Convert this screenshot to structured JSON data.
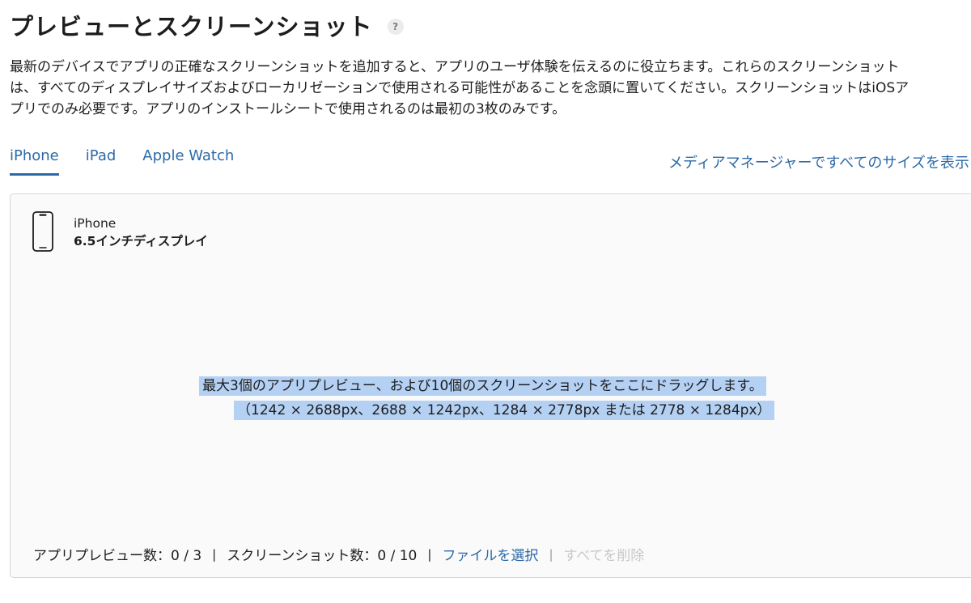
{
  "header": {
    "title": "プレビューとスクリーンショット",
    "help_icon": "?"
  },
  "description": {
    "lines": [
      "最新のデバイスでアプリの正確なスクリーンショットを追加すると、アプリのユーザ体験を伝えるのに役立ちます。これらのスクリーンショット",
      "は、すべてのディスプレイサイズおよびローカリゼーションで使用される可能性があることを念頭に置いてください。スクリーンショットはiOSア",
      "プリでのみ必要です。アプリのインストールシートで使用されるのは最初の3枚のみです。"
    ]
  },
  "tabs": [
    {
      "label": "iPhone",
      "active": true
    },
    {
      "label": "iPad",
      "active": false
    },
    {
      "label": "Apple Watch",
      "active": false
    }
  ],
  "media_manager_link": "メディアマネージャーですべてのサイズを表示",
  "device": {
    "icon": "iphone-icon",
    "name": "iPhone",
    "size": "6.5インチディスプレイ"
  },
  "drop_hint": {
    "line1": "最大3個のアプリプレビュー、および10個のスクリーンショットをここにドラッグします。",
    "line2": "（1242 × 2688px、2688 × 1242px、1284 × 2778px または 2778 × 1284px）"
  },
  "footer": {
    "preview_count": "アプリプレビュー数：0 / 3",
    "screenshot_count": "スクリーンショット数：0 / 10",
    "choose_file": "ファイルを選択",
    "delete_all": "すべてを削除",
    "separator": "|"
  },
  "colors": {
    "link": "#2c6aa8",
    "highlight": "#b4d1f3",
    "disabled": "#c8c8c8"
  }
}
